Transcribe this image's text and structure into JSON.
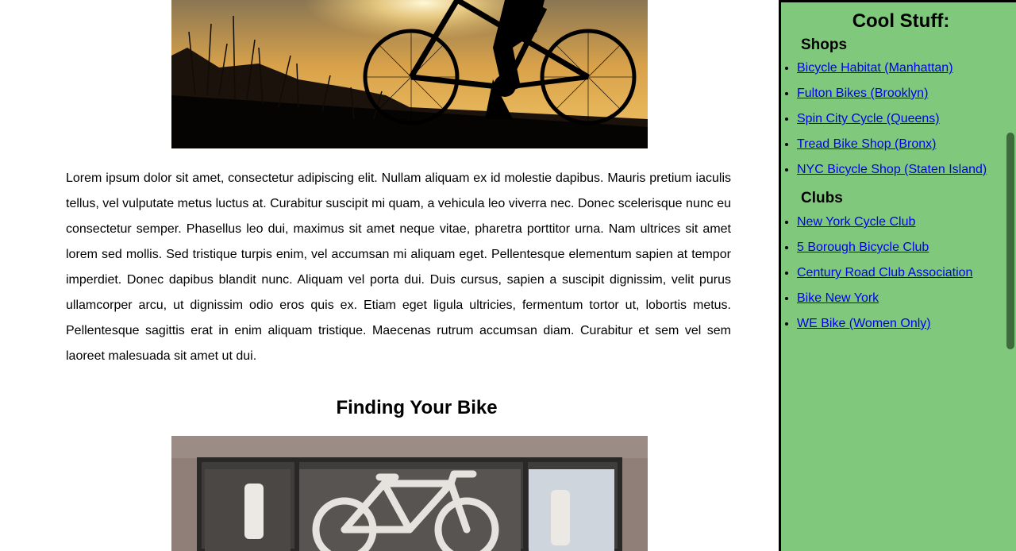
{
  "article": {
    "paragraph": "Lorem ipsum dolor sit amet, consectetur adipiscing elit. Nullam aliquam ex id molestie dapibus. Mauris pretium iaculis tellus, vel vulputate metus luctus at. Curabitur suscipit mi quam, a vehicula leo viverra nec. Donec scelerisque nunc eu consectetur semper. Phasellus leo dui, maximus sit amet neque vitae, pharetra porttitor urna. Nam ultrices sit amet lorem sed mollis. Sed tristique turpis enim, vel accumsan mi aliquam eget. Pellentesque elementum sapien at tempor imperdiet. Donec dapibus blandit nunc. Aliquam vel porta dui. Duis cursus, sapien a suscipit dignissim, velit purus ullamcorper arcu, ut dignissim odio eros quis ex. Etiam eget ligula ultricies, fermentum tortor ut, lobortis metus. Pellentesque sagittis erat in enim aliquam tristique. Maecenas rutrum accumsan diam. Curabitur et sem vel sem laoreet malesuada sit amet ut dui.",
    "section_heading": "Finding Your Bike"
  },
  "sidebar": {
    "title": "Cool Stuff:",
    "shops_heading": "Shops",
    "shops": [
      "Bicycle Habitat (Manhattan)",
      "Fulton Bikes (Brooklyn)",
      "Spin City Cycle (Queens)",
      "Tread Bike Shop (Bronx)",
      "NYC Bicycle Shop (Staten Island)"
    ],
    "clubs_heading": "Clubs",
    "clubs": [
      "New York Cycle Club",
      "5 Borough Bicycle Club",
      "Century Road Club Association",
      "Bike New York",
      "WE Bike (Women Only)"
    ]
  },
  "colors": {
    "sidebar_bg": "#80c97c",
    "link": "#0000ee",
    "scrollbar": "#3d6b3c"
  }
}
